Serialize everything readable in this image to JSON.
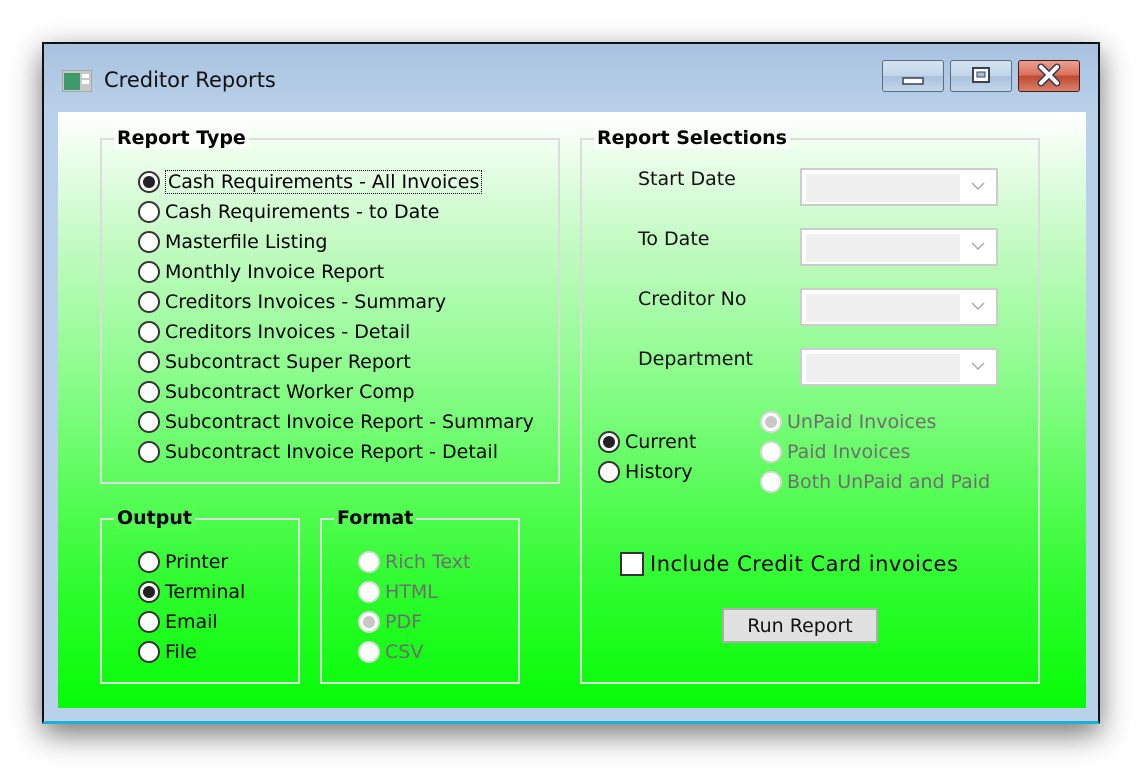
{
  "window": {
    "title": "Creditor Reports",
    "controls": {
      "minimize": "minimize",
      "maximize": "maximize",
      "close": "close"
    }
  },
  "report_type": {
    "title": "Report Type",
    "selected_index": 0,
    "options": [
      "Cash Requirements - All Invoices",
      "Cash Requirements - to Date",
      "Masterfile Listing",
      "Monthly Invoice Report",
      "Creditors Invoices - Summary",
      "Creditors Invoices - Detail",
      "Subcontract Super Report",
      "Subcontract Worker Comp",
      "Subcontract Invoice Report - Summary",
      "Subcontract Invoice Report - Detail"
    ]
  },
  "output": {
    "title": "Output",
    "selected": "Terminal",
    "options": [
      "Printer",
      "Terminal",
      "Email",
      "File"
    ]
  },
  "format": {
    "title": "Format",
    "enabled": false,
    "selected": "PDF",
    "options": [
      "Rich Text",
      "HTML",
      "PDF",
      "CSV"
    ]
  },
  "report_selections": {
    "title": "Report Selections",
    "fields": [
      {
        "label": "Start Date",
        "value": ""
      },
      {
        "label": "To Date",
        "value": ""
      },
      {
        "label": "Creditor No",
        "value": ""
      },
      {
        "label": "Department",
        "value": ""
      }
    ],
    "period": {
      "selected": "Current",
      "options": [
        "Current",
        "History"
      ]
    },
    "invoice_status": {
      "enabled": false,
      "selected": "UnPaid Invoices",
      "options": [
        "UnPaid Invoices",
        "Paid Invoices",
        "Both UnPaid and Paid"
      ]
    },
    "include_credit_card": {
      "label": "Include Credit Card invoices",
      "checked": false
    },
    "run_button": "Run Report"
  },
  "colors": {
    "client_bottom": "#06fc06",
    "titlebar": "#b9d1ea",
    "close_button": "#c04a32"
  }
}
